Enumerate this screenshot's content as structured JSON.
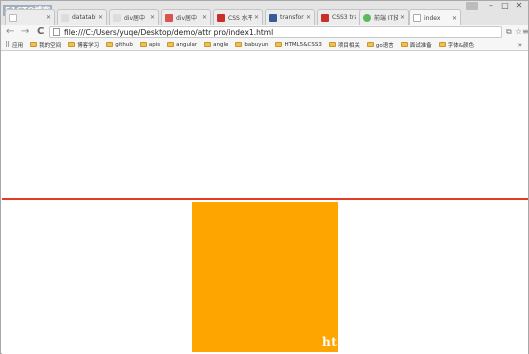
{
  "browser": {
    "brand_text": "51CTO博客",
    "tabs": [
      {
        "title": "",
        "favicon_color": "#ffffff"
      },
      {
        "title": "datatabl",
        "favicon_color": "#dddddd"
      },
      {
        "title": "div居中",
        "favicon_color": "#dddddd"
      },
      {
        "title": "div居中",
        "favicon_color": "#d9534f"
      },
      {
        "title": "CSS 水平",
        "favicon_color": "#c9302c"
      },
      {
        "title": "transfor",
        "favicon_color": "#3b5998"
      },
      {
        "title": "CSS3 tra",
        "favicon_color": "#c9302c"
      },
      {
        "title": "前端 IT技",
        "favicon_color": "#5cb85c"
      },
      {
        "title": "index",
        "favicon_color": "#eeeeee"
      }
    ],
    "window_controls": {
      "minimize": "–",
      "maximize": "□",
      "close": "✕"
    }
  },
  "toolbar": {
    "back": "←",
    "forward": "→",
    "reload": "C",
    "url": "file:///C:/Users/yuqe/Desktop/demo/attr pro/index1.html",
    "icons": {
      "translate": "⧉",
      "star": "☆",
      "menu": "≡"
    }
  },
  "bookmarks": {
    "apps_label": "应用",
    "items": [
      "我的空间",
      "博客学习",
      "github",
      "apis",
      "angular",
      "angle",
      "babuyun",
      "HTML5&CSS3",
      "项目相关",
      "go语言",
      "面试准备",
      "字体&颜色"
    ],
    "more": "»"
  },
  "page": {
    "watermark": "ht",
    "colors": {
      "line": "#e53a22",
      "box": "#ffa500"
    }
  }
}
